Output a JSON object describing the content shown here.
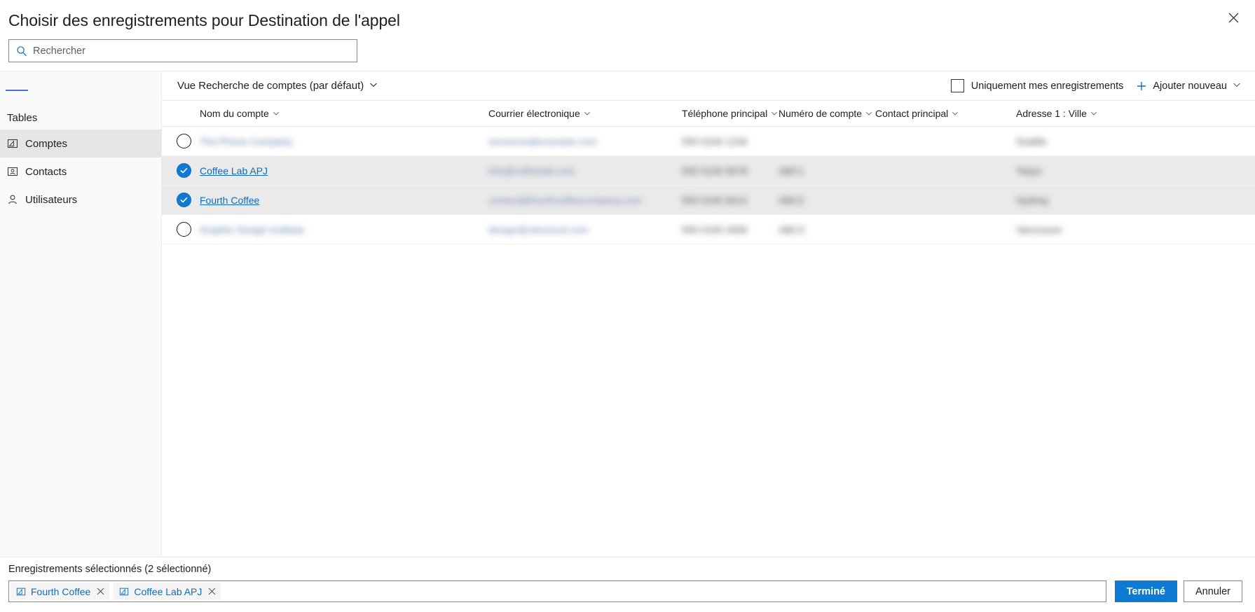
{
  "dialog": {
    "title": "Choisir des enregistrements pour Destination de l'appel",
    "close_icon": "close-icon"
  },
  "search": {
    "placeholder": "Rechercher",
    "value": "",
    "icon": "search-icon"
  },
  "sidebar": {
    "menu_icon": "hamburger-menu-icon",
    "section_title": "Tables",
    "items": [
      {
        "label": "Comptes",
        "icon": "account-icon",
        "selected": true
      },
      {
        "label": "Contacts",
        "icon": "contact-icon",
        "selected": false
      },
      {
        "label": "Utilisateurs",
        "icon": "user-icon",
        "selected": false
      }
    ]
  },
  "toolbar": {
    "view_label": "Vue Recherche de comptes (par défaut)",
    "view_chevron_icon": "chevron-down-icon",
    "my_records_label": "Uniquement mes enregistrements",
    "my_records_checked": false,
    "add_new_label": "Ajouter nouveau",
    "add_new_icon": "plus-icon",
    "add_new_chevron_icon": "chevron-down-icon"
  },
  "grid": {
    "columns": [
      {
        "label": "Nom du compte",
        "key": "name"
      },
      {
        "label": "Courrier électronique",
        "key": "email"
      },
      {
        "label": "Téléphone principal",
        "key": "phone"
      },
      {
        "label": "Numéro de compte",
        "key": "account"
      },
      {
        "label": "Contact principal",
        "key": "contact"
      },
      {
        "label": "Adresse 1 : Ville",
        "key": "city"
      }
    ],
    "rows": [
      {
        "selected": false,
        "redacted": true,
        "name": "The Phone Company",
        "email": "someone@example.com",
        "phone": "555 0100 1234",
        "account": "",
        "contact": "",
        "city": "Seattle"
      },
      {
        "selected": true,
        "redacted": false,
        "name": "Coffee Lab APJ",
        "email": "info@coffeelab.com",
        "phone": "555 0100 5678",
        "account": "ABC1",
        "contact": "",
        "city": "Tokyo"
      },
      {
        "selected": true,
        "redacted": false,
        "name": "Fourth Coffee",
        "email": "contact@fourthcoffeecompany.com",
        "phone": "555 0100 9012",
        "account": "ABC2",
        "contact": "",
        "city": "Sydney"
      },
      {
        "selected": false,
        "redacted": true,
        "name": "Graphic Design Institute",
        "email": "design@relecloud.com",
        "phone": "555 0100 3456",
        "account": "ABC3",
        "contact": "",
        "city": "Vancouver"
      }
    ]
  },
  "footer": {
    "selected_label": "Enregistrements sélectionnés (2 sélectionné)",
    "chips": [
      {
        "label": "Fourth Coffee",
        "icon": "account-icon",
        "remove_icon": "close-icon"
      },
      {
        "label": "Coffee Lab APJ",
        "icon": "account-icon",
        "remove_icon": "close-icon"
      }
    ],
    "done_label": "Terminé",
    "cancel_label": "Annuler"
  },
  "colors": {
    "accent": "#0f7ad4",
    "link": "#0f6cbd",
    "selected_row": "#ebeaea",
    "sidebar_bg": "#fafafa",
    "border": "#edebe9"
  }
}
